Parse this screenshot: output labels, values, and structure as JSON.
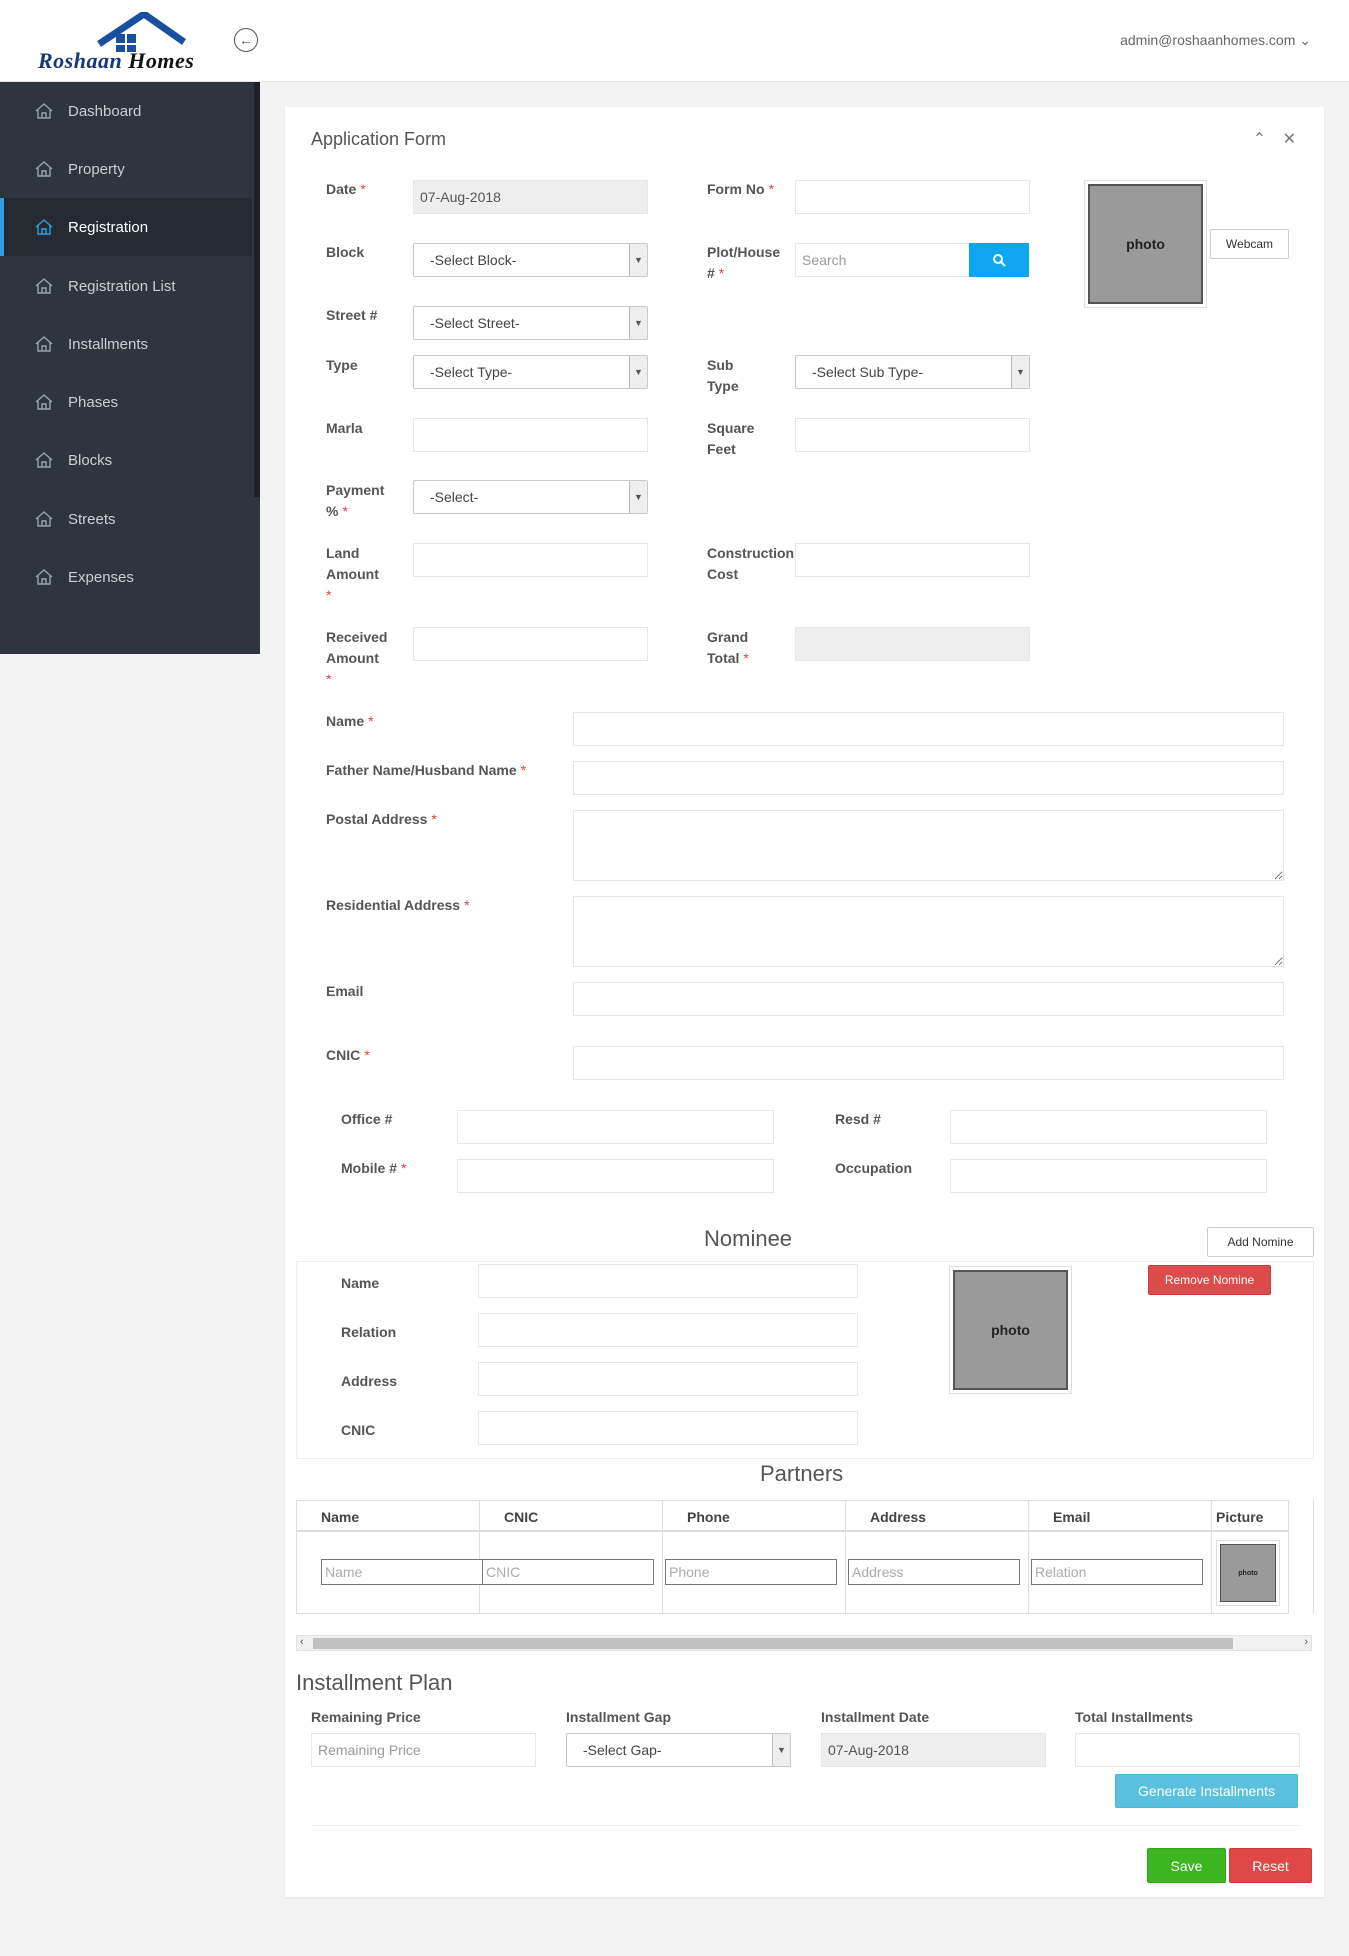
{
  "app": {
    "logo_main": "Roshaan",
    "logo_sub": "Homes",
    "user_email": "admin@roshaanhomes.com"
  },
  "sidebar": {
    "items": [
      {
        "label": "Dashboard"
      },
      {
        "label": "Property"
      },
      {
        "label": "Registration"
      },
      {
        "label": "Registration List"
      },
      {
        "label": "Installments"
      },
      {
        "label": "Phases"
      },
      {
        "label": "Blocks"
      },
      {
        "label": "Streets"
      },
      {
        "label": "Expenses"
      }
    ],
    "active": "Registration"
  },
  "form": {
    "title": "Application Form",
    "date_label": "Date",
    "date_value": "07-Aug-2018",
    "form_no_label": "Form No",
    "block_label": "Block",
    "block_value": "-Select Block-",
    "plot_label": "Plot/House #",
    "plot_placeholder": "Search",
    "street_label": "Street #",
    "street_value": "-Select Street-",
    "type_label": "Type",
    "type_value": "-Select Type-",
    "subtype_label": "Sub Type",
    "subtype_value": "-Select Sub Type-",
    "marla_label": "Marla",
    "sqft_label": "Square Feet",
    "payment_label": "Payment %",
    "payment_value": "-Select-",
    "land_label": "Land Amount",
    "construction_label": "Construction Cost",
    "received_label": "Received Amount",
    "grand_label": "Grand Total",
    "photo_text": "photo",
    "webcam_label": "Webcam",
    "name_label": "Name",
    "father_label": "Father Name/Husband Name",
    "postal_label": "Postal Address",
    "residential_label": "Residential Address",
    "email_label": "Email",
    "cnic_label": "CNIC",
    "office_label": "Office #",
    "resd_label": "Resd #",
    "mobile_label": "Mobile #",
    "occupation_label": "Occupation"
  },
  "nominee": {
    "title": "Nominee",
    "add_label": "Add Nomine",
    "remove_label": "Remove Nomine",
    "name_label": "Name",
    "relation_label": "Relation",
    "address_label": "Address",
    "cnic_label": "CNIC",
    "photo_text": "photo"
  },
  "partners": {
    "title": "Partners",
    "columns": [
      "Name",
      "CNIC",
      "Phone",
      "Address",
      "Email",
      "Picture"
    ],
    "placeholders": [
      "Name",
      "CNIC",
      "Phone",
      "Address",
      "Relation"
    ],
    "photo_text": "photo"
  },
  "installment": {
    "title": "Installment Plan",
    "remaining_label": "Remaining Price",
    "remaining_placeholder": "Remaining Price",
    "gap_label": "Installment Gap",
    "gap_value": "-Select Gap-",
    "date_label": "Installment Date",
    "date_value": "07-Aug-2018",
    "total_label": "Total Installments",
    "generate_label": "Generate Installments"
  },
  "actions": {
    "save_label": "Save",
    "reset_label": "Reset"
  }
}
